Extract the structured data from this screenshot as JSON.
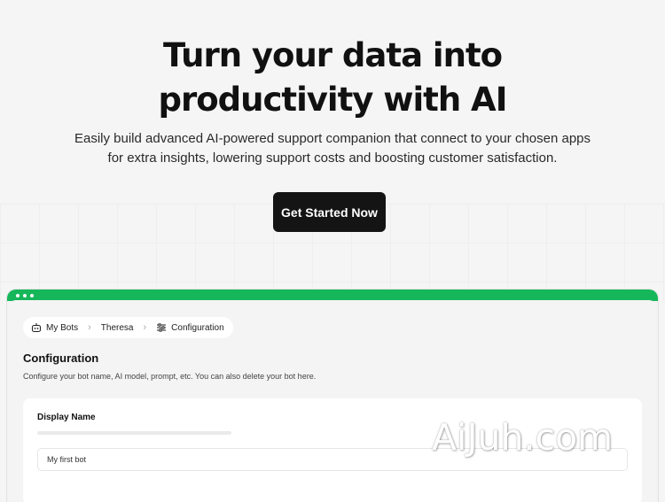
{
  "hero": {
    "headline": "Turn your data into productivity with AI",
    "subtext": "Easily build advanced AI-powered support companion that connect to your chosen apps for extra insights, lowering support costs and boosting customer satisfaction.",
    "cta_label": "Get Started Now"
  },
  "app": {
    "accent_color": "#16b75a",
    "breadcrumb": [
      {
        "label": "My Bots",
        "icon": "robot-icon"
      },
      {
        "label": "Theresa",
        "icon": ""
      },
      {
        "label": "Configuration",
        "icon": "sliders-icon"
      }
    ],
    "section_title": "Configuration",
    "section_description": "Configure your bot name, AI model, prompt, etc. You can also delete your bot here.",
    "display_name_label": "Display Name",
    "display_name_value": "My first bot"
  },
  "watermark": "AiJuh.com"
}
